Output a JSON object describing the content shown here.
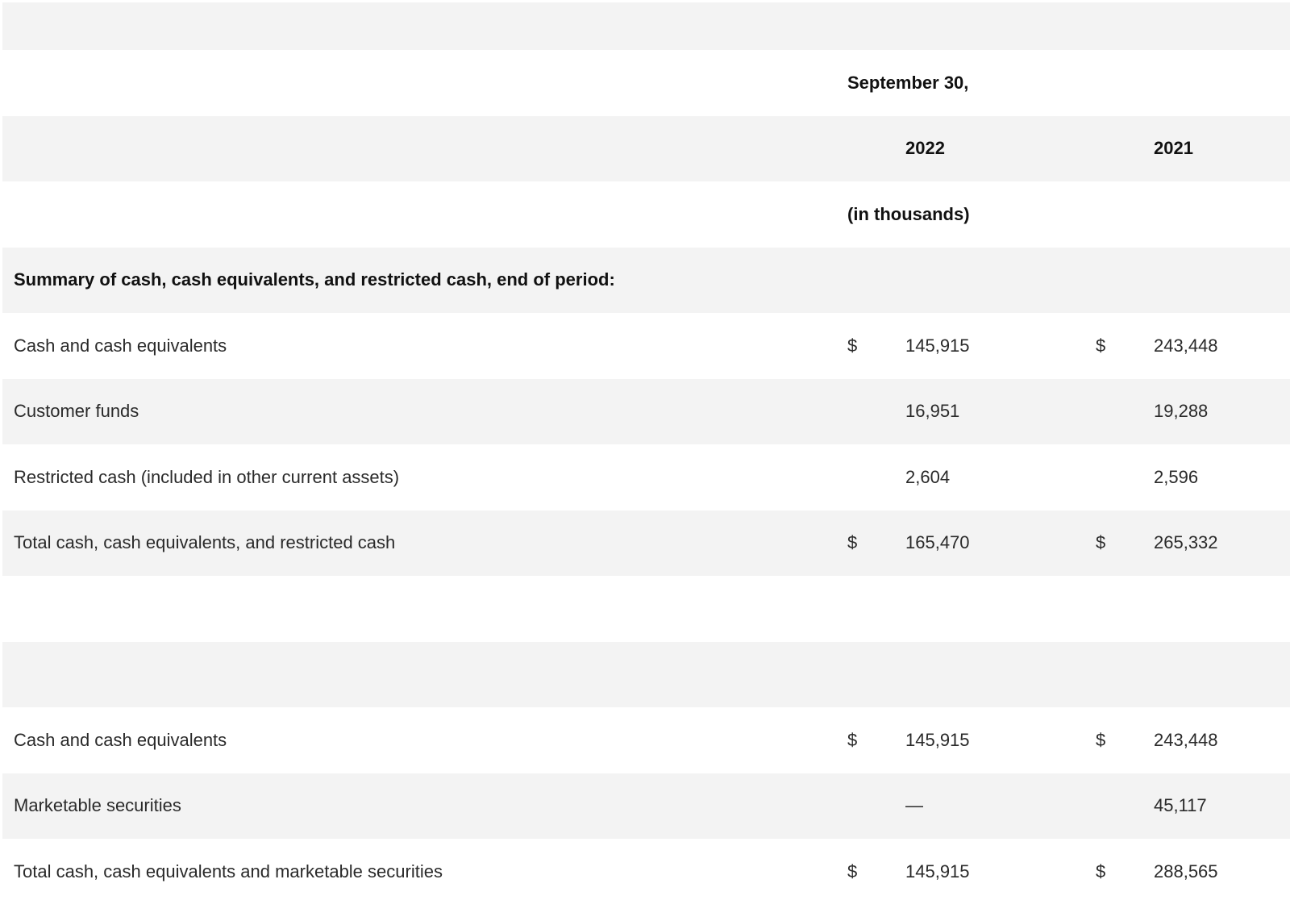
{
  "header": {
    "period_label": "September 30,",
    "year_1": "2022",
    "year_2": "2021",
    "units": "(in thousands)"
  },
  "section_1": {
    "title": "Summary of cash, cash equivalents, and restricted cash, end of period:",
    "rows": [
      {
        "label": "Cash and cash equivalents",
        "cur1": "$",
        "val1": "145,915",
        "cur2": "$",
        "val2": "243,448"
      },
      {
        "label": "Customer funds",
        "cur1": "",
        "val1": "16,951",
        "cur2": "",
        "val2": "19,288"
      },
      {
        "label": "Restricted cash (included in other current assets)",
        "cur1": "",
        "val1": "2,604",
        "cur2": "",
        "val2": "2,596"
      },
      {
        "label": "Total cash, cash equivalents, and restricted cash",
        "cur1": "$",
        "val1": "165,470",
        "cur2": "$",
        "val2": "265,332"
      }
    ]
  },
  "section_2": {
    "rows": [
      {
        "label": "Cash and cash equivalents",
        "cur1": "$",
        "val1": "145,915",
        "cur2": "$",
        "val2": "243,448"
      },
      {
        "label": "Marketable securities",
        "cur1": "",
        "val1": "—",
        "cur2": "",
        "val2": "45,117"
      },
      {
        "label": "Total cash, cash equivalents and marketable securities",
        "cur1": "$",
        "val1": "145,915",
        "cur2": "$",
        "val2": "288,565"
      }
    ]
  }
}
